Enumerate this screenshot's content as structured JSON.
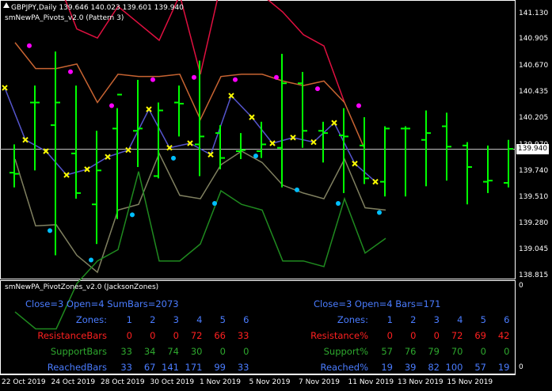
{
  "header": {
    "symbol_line": "GBPJPY,Daily  139.646 140.023 139.601 139.940",
    "indicator_main": "smNewPA_Pivots_v2.0 (Pattern 3)"
  },
  "subwindow": {
    "title": "smNewPA_PivotZones_v2.0 (JacksonZones)",
    "scale_top": "0",
    "scale_bottom": "0",
    "left": {
      "summary": "Close=3  Open=4  SumBars=2073",
      "zones_label": "Zones:",
      "zones": [
        "1",
        "2",
        "3",
        "4",
        "5",
        "6"
      ],
      "resistance_label": "ResistanceBars",
      "resistance": [
        "0",
        "0",
        "0",
        "72",
        "66",
        "33"
      ],
      "support_label": "SupportBars",
      "support": [
        "33",
        "34",
        "74",
        "30",
        "0",
        "0"
      ],
      "reached_label": "ReachedBars",
      "reached": [
        "33",
        "67",
        "141",
        "171",
        "99",
        "33"
      ]
    },
    "right": {
      "summary": "Close=3  Open=4  Bars=171",
      "zones_label": "Zones:",
      "zones": [
        "1",
        "2",
        "3",
        "4",
        "5",
        "6"
      ],
      "resistance_label": "Resistance%",
      "resistance": [
        "0",
        "0",
        "0",
        "72",
        "69",
        "42"
      ],
      "support_label": "Support%",
      "support": [
        "57",
        "76",
        "79",
        "70",
        "0",
        "0"
      ],
      "reached_label": "Reached%",
      "reached": [
        "19",
        "39",
        "82",
        "100",
        "57",
        "19"
      ]
    }
  },
  "price_axis": {
    "labels": [
      "141.130",
      "140.905",
      "140.670",
      "140.435",
      "140.205",
      "139.970",
      "139.740",
      "139.510",
      "139.280",
      "139.045",
      "138.815"
    ],
    "current_price": "139.940"
  },
  "time_axis": {
    "labels": [
      "22 Oct 2019",
      "24 Oct 2019",
      "28 Oct 2019",
      "30 Oct 2019",
      "1 Nov 2019",
      "5 Nov 2019",
      "7 Nov 2019",
      "11 Nov 2019",
      "13 Nov 2019",
      "15 Nov 2019"
    ]
  },
  "colors": {
    "bar": "#00ff00",
    "resistance_text": "#ff2020",
    "support_text": "#2ea82e",
    "reached_text": "#4a7cff",
    "pivot_line": "#5555cc",
    "r1_line": "#c86432",
    "r2_line": "#e01040",
    "s1_line": "#808060",
    "s2_line": "#1f8a1f",
    "magenta_dot": "#ff00ff",
    "cyan_dot": "#00bfff",
    "pivot_marker": "#ffff00"
  },
  "chart_data": {
    "type": "ohlc",
    "ylim": [
      138.815,
      141.13
    ],
    "bars": [
      {
        "o": 139.73,
        "h": 139.98,
        "l": 139.6,
        "c": 139.72
      },
      {
        "o": 140.35,
        "h": 140.5,
        "l": 139.75,
        "c": 140.35
      },
      {
        "o": 140.15,
        "h": 140.8,
        "l": 139.0,
        "c": 140.35
      },
      {
        "o": 139.9,
        "h": 140.5,
        "l": 139.5,
        "c": 139.55
      },
      {
        "o": 139.45,
        "h": 140.1,
        "l": 139.1,
        "c": 139.75
      },
      {
        "o": 140.12,
        "h": 140.3,
        "l": 139.32,
        "c": 140.42
      },
      {
        "o": 140.1,
        "h": 140.55,
        "l": 139.78,
        "c": 140.12
      },
      {
        "o": 139.7,
        "h": 140.35,
        "l": 139.68,
        "c": 140.28
      },
      {
        "o": 140.35,
        "h": 140.5,
        "l": 140.05,
        "c": 140.34
      },
      {
        "o": 139.98,
        "h": 140.72,
        "l": 139.7,
        "c": 140.05
      },
      {
        "o": 140.08,
        "h": 140.15,
        "l": 139.76,
        "c": 139.86
      },
      {
        "o": 139.92,
        "h": 140.08,
        "l": 139.85,
        "c": 139.93
      },
      {
        "o": 139.92,
        "h": 140.18,
        "l": 139.86,
        "c": 139.98
      },
      {
        "o": 139.95,
        "h": 140.78,
        "l": 139.6,
        "c": 140.52
      },
      {
        "o": 140.52,
        "h": 140.62,
        "l": 139.95,
        "c": 140.1
      },
      {
        "o": 140.1,
        "h": 140.18,
        "l": 139.82,
        "c": 140.08
      },
      {
        "o": 140.06,
        "h": 140.3,
        "l": 139.55,
        "c": 140.05
      },
      {
        "o": 139.97,
        "h": 140.22,
        "l": 139.63,
        "c": 139.68
      },
      {
        "o": 139.65,
        "h": 140.14,
        "l": 139.52,
        "c": 140.12
      },
      {
        "o": 140.12,
        "h": 140.14,
        "l": 139.52,
        "c": 140.12
      },
      {
        "o": 140.02,
        "h": 140.28,
        "l": 139.61,
        "c": 140.08
      },
      {
        "o": 140.14,
        "h": 140.26,
        "l": 139.66,
        "c": 139.96
      },
      {
        "o": 139.97,
        "h": 140.0,
        "l": 139.45,
        "c": 139.78
      },
      {
        "o": 139.65,
        "h": 139.97,
        "l": 139.55,
        "c": 139.66
      },
      {
        "o": 139.64,
        "h": 140.02,
        "l": 139.6,
        "c": 139.94
      }
    ],
    "pivot": [
      140.48,
      140.02,
      139.92,
      139.71,
      139.76,
      139.87,
      139.93,
      140.29,
      139.95,
      139.99,
      139.89,
      140.41,
      140.22,
      139.99,
      140.04,
      140.0,
      140.17,
      139.81,
      139.65
    ],
    "r1": [
      140.88,
      140.65,
      140.65,
      140.69,
      140.35,
      140.6,
      140.58,
      140.58,
      140.6,
      140.2,
      140.58,
      140.6,
      140.6,
      140.54,
      140.5,
      140.54,
      140.35,
      139.93
    ],
    "r2": [
      141.5,
      141.56,
      141.46,
      141.0,
      140.92,
      141.2,
      141.05,
      140.9,
      141.3,
      140.6,
      141.4,
      141.3,
      141.3,
      141.15,
      140.95,
      140.85,
      140.35
    ],
    "s1": [
      139.85,
      139.26,
      139.27,
      139.0,
      138.85,
      139.4,
      139.45,
      139.9,
      139.53,
      139.5,
      139.8,
      139.92,
      139.82,
      139.62,
      139.55,
      139.5,
      139.85,
      139.42,
      139.4
    ],
    "s2": [
      138.5,
      138.35,
      138.35,
      138.75,
      138.95,
      139.05,
      139.74,
      138.95,
      138.95,
      139.1,
      139.57,
      139.45,
      139.4,
      138.95,
      138.95,
      138.9,
      139.5,
      139.02,
      139.15
    ]
  },
  "labels": {
    "chart_aria": "GBPJPY daily price chart with pivot levels"
  }
}
